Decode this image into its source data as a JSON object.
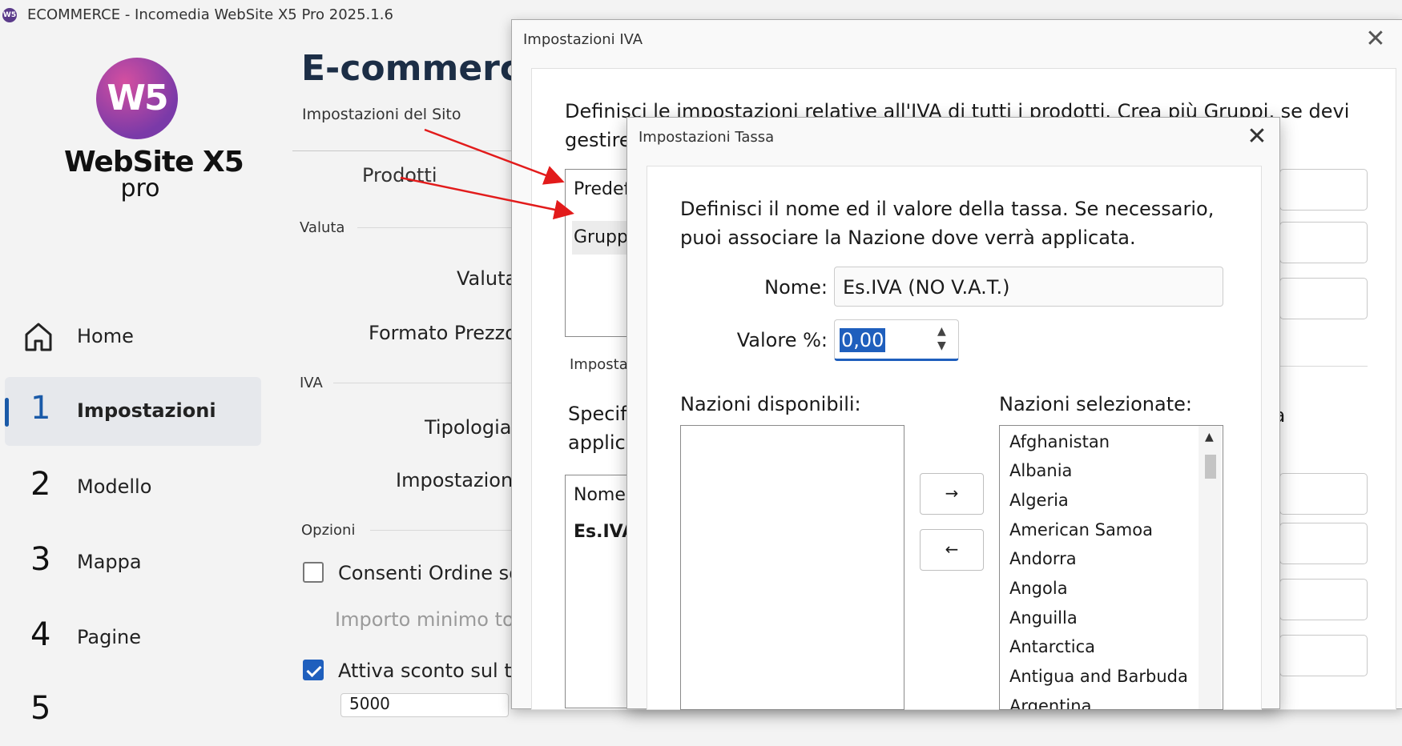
{
  "window": {
    "title": "ECOMMERCE - Incomedia WebSite X5 Pro 2025.1.6",
    "icon": "W5"
  },
  "sidebar": {
    "logo_text": "W5",
    "logo_name": "WebSite X5",
    "logo_sub": "pro",
    "items": [
      {
        "num": "",
        "label": "Home"
      },
      {
        "num": "1",
        "label": "Impostazioni"
      },
      {
        "num": "2",
        "label": "Modello"
      },
      {
        "num": "3",
        "label": "Mappa"
      },
      {
        "num": "4",
        "label": "Pagine"
      },
      {
        "num": "5",
        "label": ""
      }
    ]
  },
  "main": {
    "title": "E-commerce",
    "subtitle": "Impostazioni del Sito",
    "tab": "Prodotti",
    "section_valuta": "Valuta",
    "label_valuta": "Valuta",
    "label_formato": "Formato Prezzo",
    "section_iva": "IVA",
    "label_tipologia": "Tipologia",
    "label_impostazioni": "Impostazioni",
    "section_opzioni": "Opzioni",
    "opt_consenti": "Consenti Ordine so",
    "opt_importo": "Importo minimo to",
    "opt_sconto": "Attiva sconto sul to",
    "field_value": "5000"
  },
  "iva_dialog": {
    "title": "Impostazioni IVA",
    "description": "Definisci le impostazioni relative all'IVA di tutti i prodotti. Crea più Gruppi, se devi",
    "description2": "gestire",
    "groups": [
      "Predef",
      "Grupp"
    ],
    "imposta_label": "Imposta",
    "specif_line1": "Specifi",
    "specif_line2": "applica",
    "specif_tail": "la",
    "table_header": "Nome",
    "table_row": "Es.IVA"
  },
  "tassa_dialog": {
    "title": "Impostazioni Tassa",
    "description_line1": "Definisci il nome ed il valore della tassa. Se necessario,",
    "description_line2": "puoi associare la Nazione dove verrà applicata.",
    "nome_label": "Nome:",
    "nome_value": "Es.IVA (NO V.A.T.)",
    "valore_label": "Valore %:",
    "valore_value": "0,00",
    "available_label": "Nazioni disponibili:",
    "selected_label": "Nazioni selezionate:",
    "add_button": "→",
    "remove_button": "←",
    "countries": [
      "Afghanistan",
      "Albania",
      "Algeria",
      "American Samoa",
      "Andorra",
      "Angola",
      "Anguilla",
      "Antarctica",
      "Antigua and Barbuda",
      "Argentina"
    ]
  },
  "colors": {
    "accent": "#1f5fbd",
    "annotation": "#e21b1b",
    "logo": "#7a3aa8"
  }
}
